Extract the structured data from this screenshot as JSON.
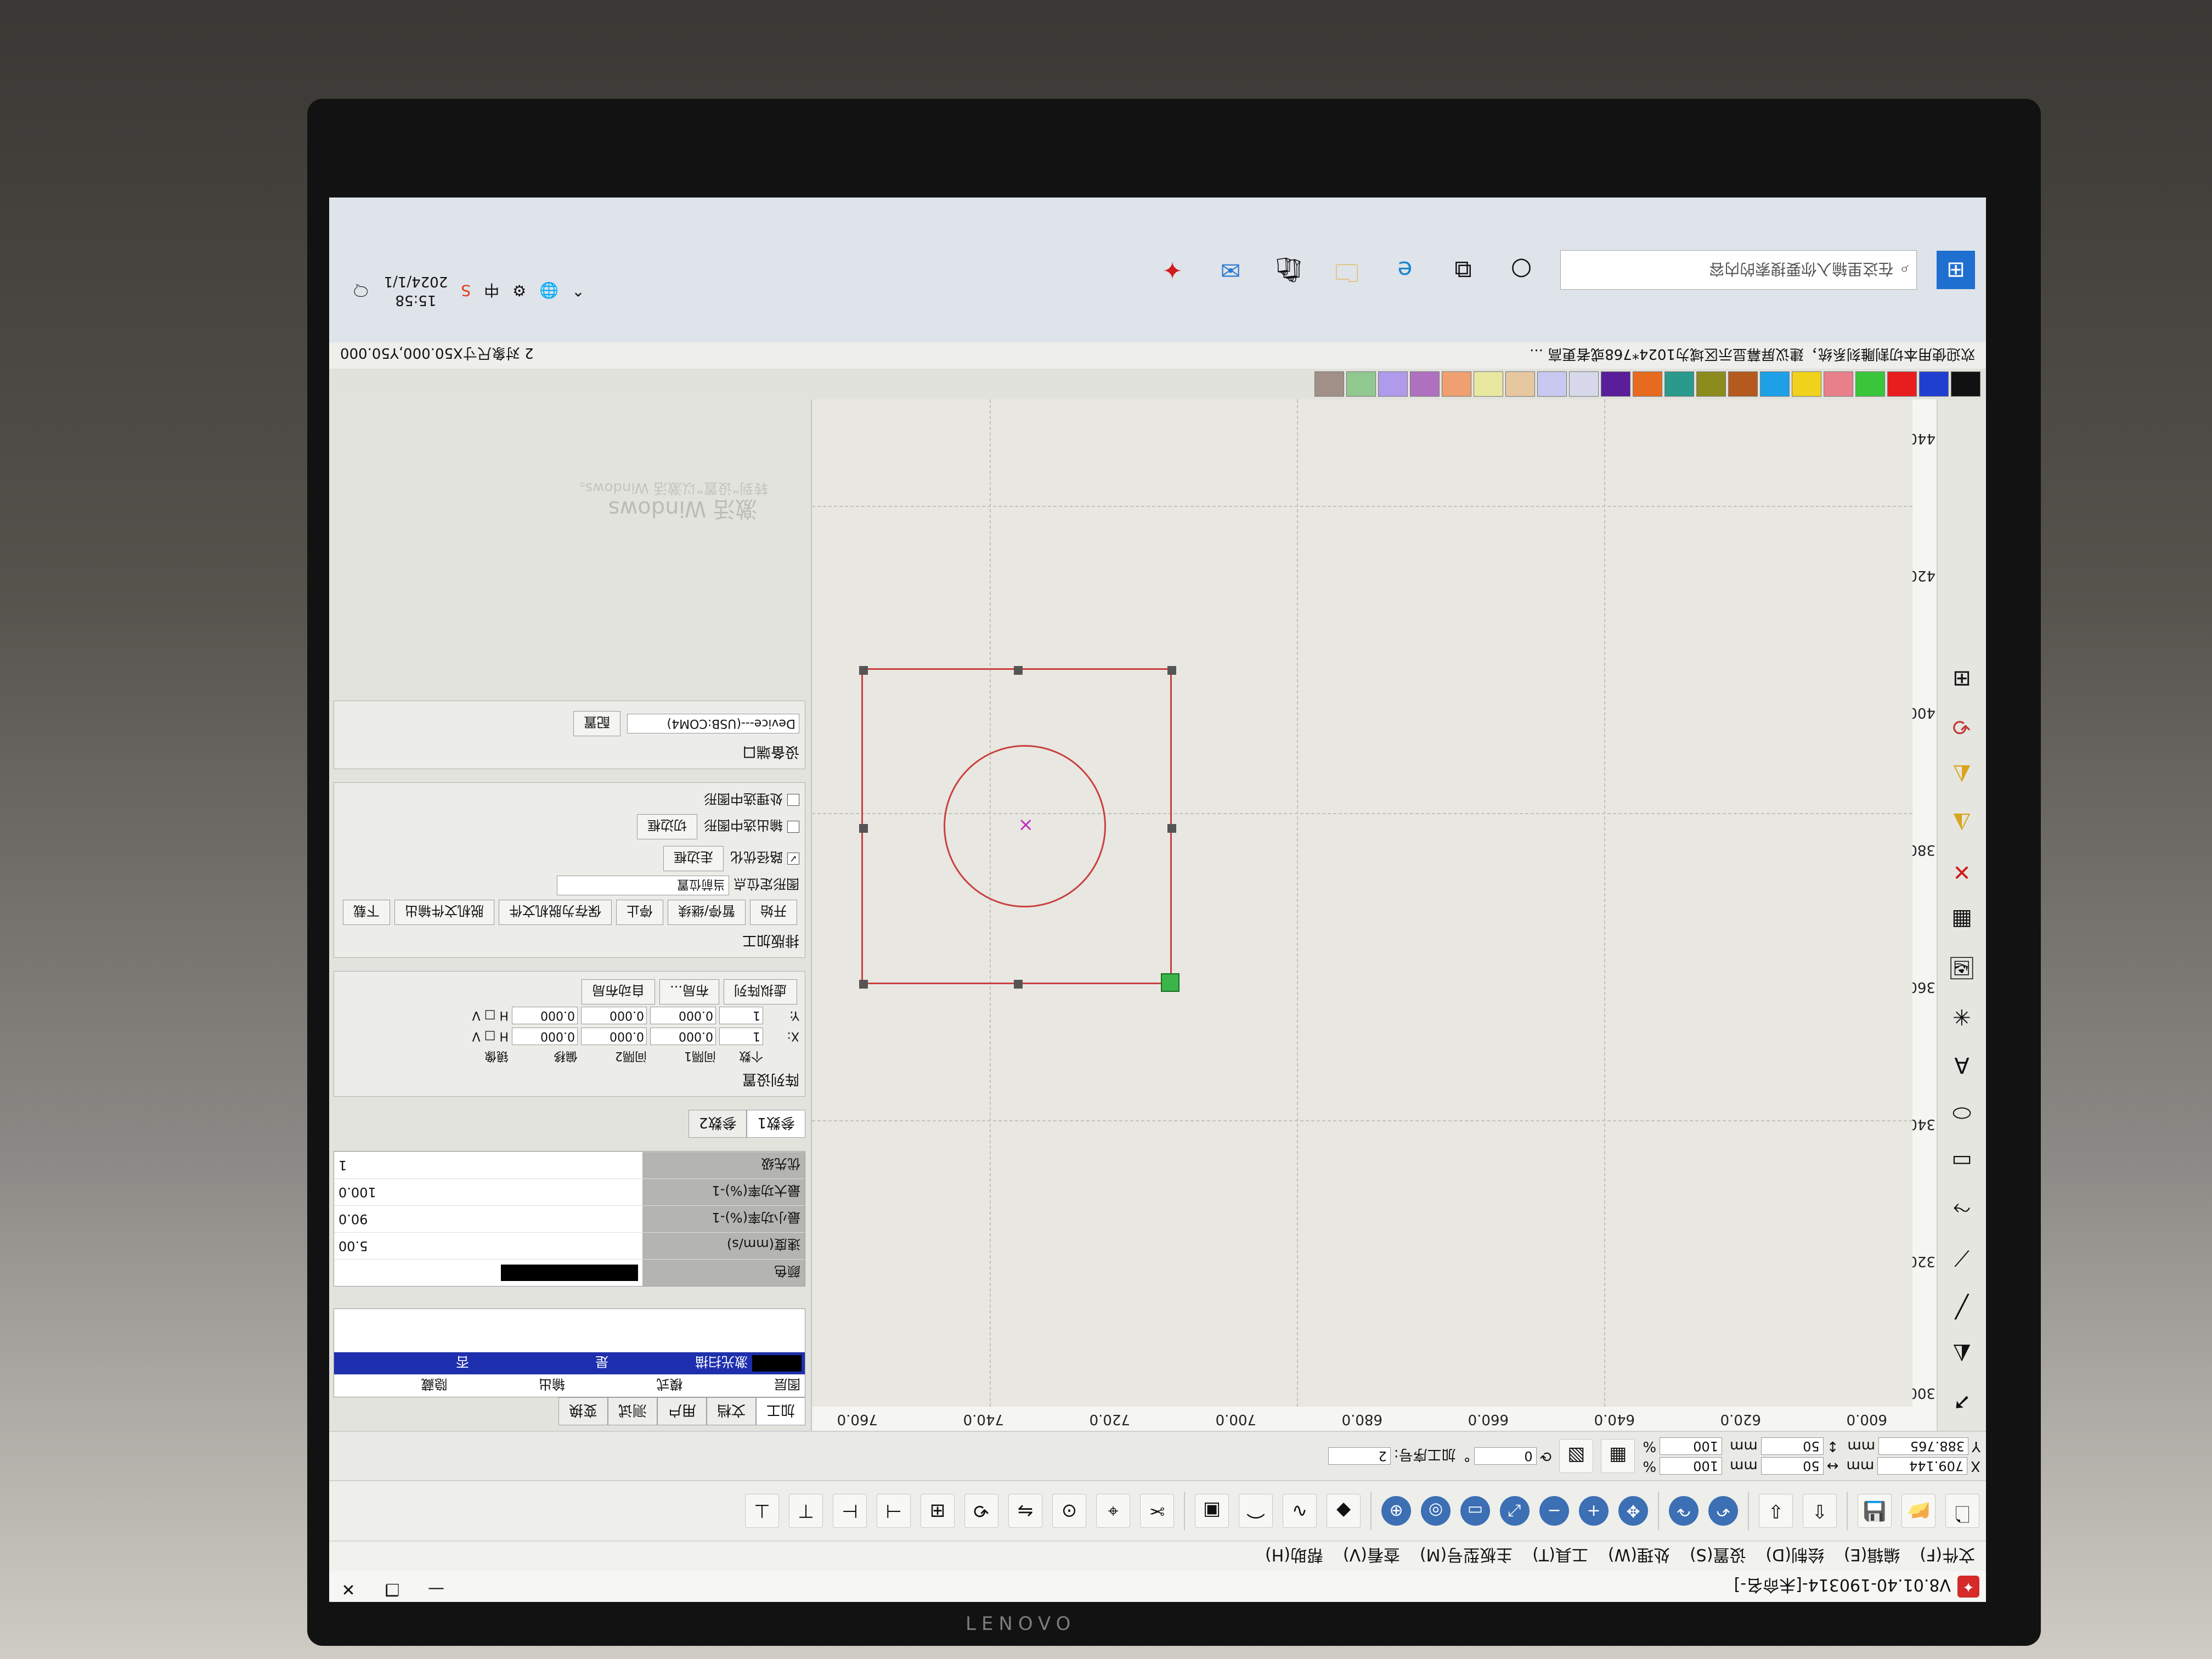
{
  "window": {
    "title": "V8.01.40-190314-[未命名-]",
    "logo_symbol": "✦",
    "controls": [
      "—",
      "❐",
      "✕"
    ]
  },
  "menu": [
    "文件(F)",
    "编辑(E)",
    "绘制(D)",
    "设置(S)",
    "处理(W)",
    "工具(T)",
    "主板型号(M)",
    "查看(V)",
    "帮助(H)"
  ],
  "props": {
    "x_value": "709.144",
    "y_value": "388.765",
    "unit": "mm",
    "w_value": "50",
    "h_value": "50",
    "w_percent": "100",
    "h_percent": "100",
    "percent": "%",
    "angle": "0",
    "degree": "°",
    "process_label": "加工序号:",
    "process_value": "2"
  },
  "ruler": {
    "top": [
      "600.0",
      "620.0",
      "640.0",
      "660.0",
      "680.0",
      "700.0",
      "720.0",
      "740.0",
      "760.0"
    ],
    "left": [
      "300",
      "320.0",
      "340.0",
      "360.0",
      "380.0",
      "400.0",
      "420.0",
      "440.0"
    ]
  },
  "panel": {
    "tabs": [
      "加工",
      "文档",
      "用户",
      "测试",
      "变换"
    ],
    "layer_headers": [
      "图层",
      "模式",
      "输出",
      "隐藏"
    ],
    "layer_row": [
      "",
      "激光扫描",
      "是",
      "否"
    ],
    "params": [
      {
        "name": "颜色",
        "value": ""
      },
      {
        "name": "速度(mm/s)",
        "value": "5.00"
      },
      {
        "name": "最小功率(%)-1",
        "value": "90.0"
      },
      {
        "name": "最大功率(%)-1",
        "value": "100.0"
      },
      {
        "name": "优先级",
        "value": "1"
      }
    ],
    "array_tabs": [
      "参数1",
      "参数2"
    ],
    "array_title": "阵列设置",
    "array_headers": [
      "",
      "个数",
      "间隔1",
      "间隔2",
      "偏移",
      "镜像"
    ],
    "array_rows": [
      [
        "X:",
        "1",
        "0.000",
        "0.000",
        "0.000",
        "H □ V"
      ],
      [
        "Y:",
        "1",
        "0.000",
        "0.000",
        "0.000",
        "H □ V"
      ]
    ],
    "array_buttons": [
      "虚拟阵列",
      "布局...",
      "自动布局"
    ],
    "process_title": "排版加工",
    "process_buttons": [
      "开始",
      "暂停/继续",
      "停止",
      "保存为脱机文件",
      "脱机文件输出",
      "下载"
    ],
    "position_label": "图形定位点",
    "position_select": "当前位置",
    "checks": [
      "路径优化",
      "输出选中图形",
      "处理选中图形"
    ],
    "side_buttons": [
      "走边框",
      "切边框"
    ],
    "port_title": "设备端口",
    "port_select": "Device---(USB:COM4)",
    "port_button": "配置",
    "watermark": "激活 Windows",
    "watermark_sub": "转到“设置”以激活 Windows。"
  },
  "palette": [
    "#111111",
    "#1f3fd1",
    "#e81e1e",
    "#3ac63a",
    "#e8808c",
    "#f0d21c",
    "#1ea0e6",
    "#b45a1e",
    "#8c8c1e",
    "#2a9a8c",
    "#e86a1e",
    "#5a1e9a",
    "#d8d8ec",
    "#c8c8f0",
    "#e6c8a0",
    "#e8e8a0",
    "#f0a070",
    "#b070c0",
    "#b09aec",
    "#90c890",
    "#a09088"
  ],
  "status": {
    "hint": "欢迎使用本切割雕刻系统，建议屏幕显示区域为1024*768或者更高 ...",
    "selection": "2 对象尺寸X50.000,Y50.000"
  },
  "taskbar": {
    "search_placeholder": "在这里输入你要搜索的内容",
    "time": "15:58",
    "date": "2024/1/1",
    "ime": "中",
    "tray_icons": [
      "⌃",
      "🌐",
      "⚙",
      "中",
      "S"
    ]
  }
}
